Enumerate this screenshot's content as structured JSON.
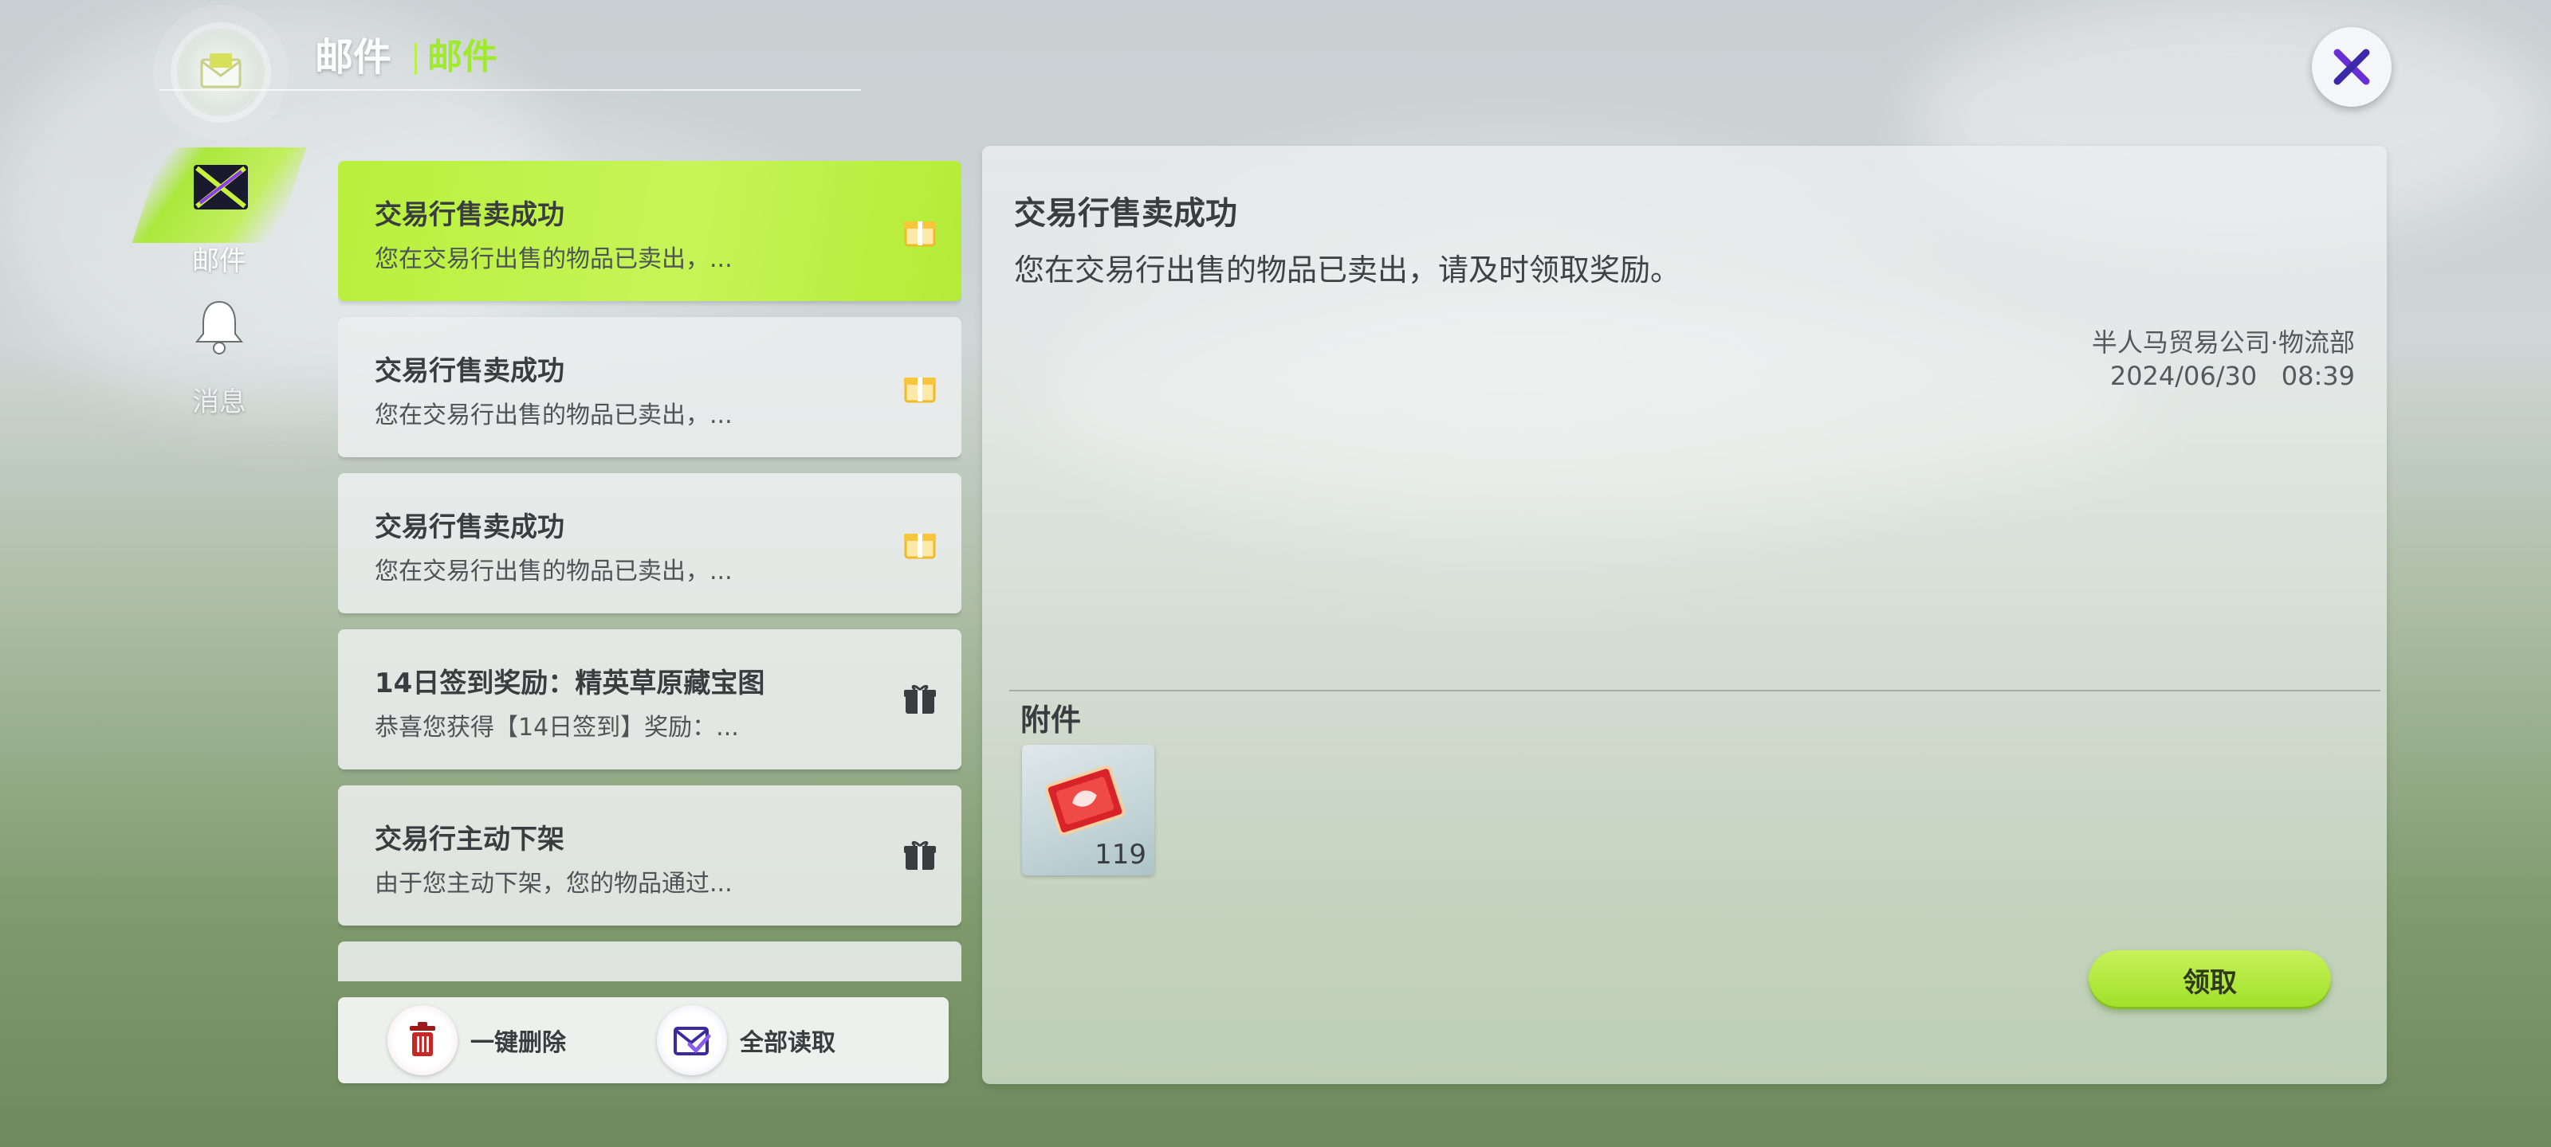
{
  "header": {
    "title": "邮件",
    "subtitle": "邮件"
  },
  "close_icon": "close-icon",
  "sidebar": {
    "items": [
      {
        "label": "邮件",
        "icon": "mail-tab-icon",
        "active": true
      },
      {
        "label": "消息",
        "icon": "bell-icon",
        "active": false
      }
    ]
  },
  "mail_list": {
    "items": [
      {
        "title": "交易行售卖成功",
        "preview": "您在交易行出售的物品已卖出，...",
        "icon": "gift-icon-unread",
        "selected": true
      },
      {
        "title": "交易行售卖成功",
        "preview": "您在交易行出售的物品已卖出，...",
        "icon": "gift-icon-unread",
        "selected": false
      },
      {
        "title": "交易行售卖成功",
        "preview": "您在交易行出售的物品已卖出，...",
        "icon": "gift-icon-unread",
        "selected": false
      },
      {
        "title": "14日签到奖励：精英草原藏宝图",
        "preview": "恭喜您获得【14日签到】奖励：...",
        "icon": "gift-icon",
        "selected": false
      },
      {
        "title": "交易行主动下架",
        "preview": "由于您主动下架，您的物品通过...",
        "icon": "gift-icon",
        "selected": false
      }
    ]
  },
  "actions": {
    "delete_all_label": "一键删除",
    "read_all_label": "全部读取"
  },
  "detail": {
    "title": "交易行售卖成功",
    "body": "您在交易行出售的物品已卖出，请及时领取奖励。",
    "sender": "半人马贸易公司·物流部",
    "date": "2024/06/30   08:39",
    "attachments_label": "附件",
    "attachments": [
      {
        "name": "red-ticket-item",
        "count": "119"
      }
    ],
    "claim_label": "领取"
  },
  "colors": {
    "accent_green": "#b8f03c",
    "header_sub": "#9fea2c",
    "close_x_purple": "#6a2ed6"
  }
}
